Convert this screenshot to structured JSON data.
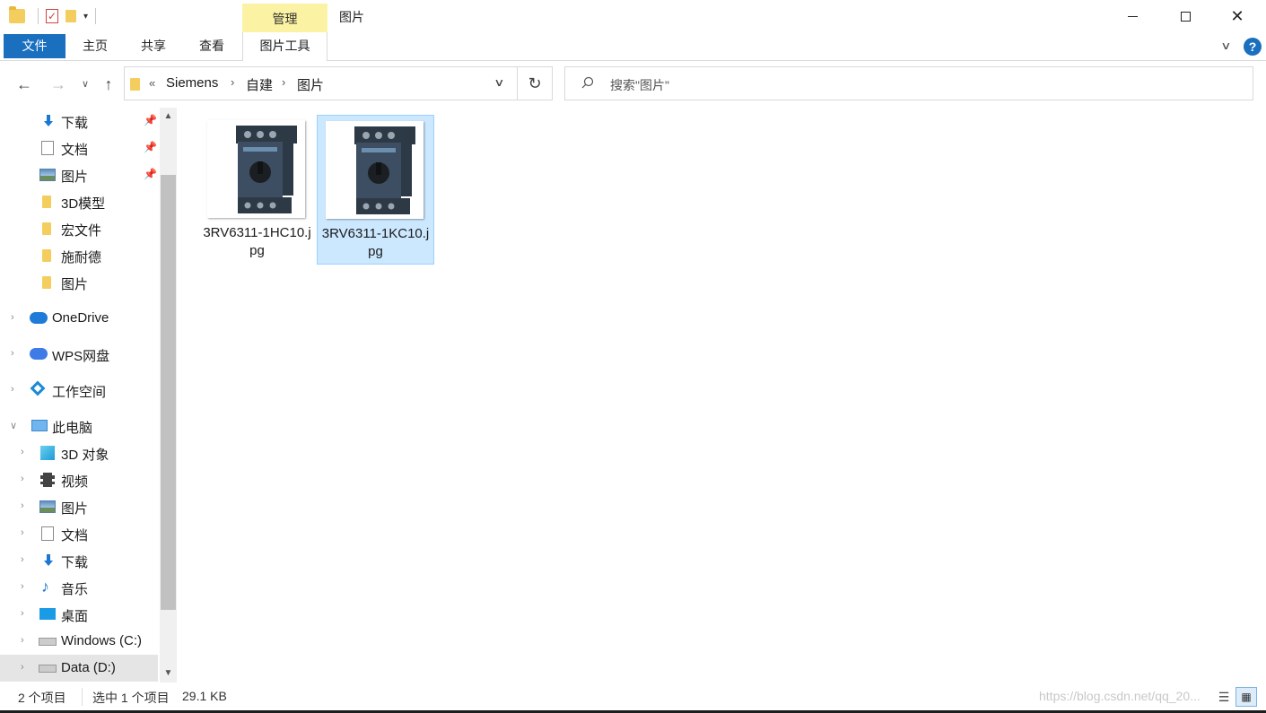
{
  "window": {
    "title": "图片",
    "context_tab": "管理"
  },
  "ribbon": {
    "tabs": [
      "文件",
      "主页",
      "共享",
      "查看",
      "图片工具"
    ]
  },
  "address": {
    "overflow": "«",
    "breadcrumbs": [
      "Siemens",
      "自建",
      "图片"
    ]
  },
  "search": {
    "placeholder": "搜索\"图片\""
  },
  "nav_tree": [
    {
      "label": "下载",
      "icon": "download-icon",
      "pinned": true
    },
    {
      "label": "文档",
      "icon": "document-icon",
      "pinned": true
    },
    {
      "label": "图片",
      "icon": "pictures-icon",
      "pinned": true
    },
    {
      "label": "3D模型",
      "icon": "folder-icon"
    },
    {
      "label": "宏文件",
      "icon": "folder-icon"
    },
    {
      "label": "施耐德",
      "icon": "folder-icon"
    },
    {
      "label": "图片",
      "icon": "folder-icon"
    },
    {
      "label": "OneDrive",
      "icon": "onedrive-cloud-icon"
    },
    {
      "label": "WPS网盘",
      "icon": "wps-cloud-icon"
    },
    {
      "label": "工作空间",
      "icon": "workspace-icon"
    },
    {
      "label": "此电脑",
      "icon": "this-pc-icon"
    },
    {
      "label": "3D 对象",
      "icon": "3d-objects-icon"
    },
    {
      "label": "视频",
      "icon": "video-icon"
    },
    {
      "label": "图片",
      "icon": "pictures-icon"
    },
    {
      "label": "文档",
      "icon": "document-icon"
    },
    {
      "label": "下载",
      "icon": "download-icon"
    },
    {
      "label": "音乐",
      "icon": "music-icon"
    },
    {
      "label": "桌面",
      "icon": "desktop-icon"
    },
    {
      "label": "Windows (C:)",
      "icon": "windows-drive-icon"
    },
    {
      "label": "Data (D:)",
      "icon": "drive-icon"
    }
  ],
  "files": [
    {
      "name": "3RV6311-1HC10.jpg",
      "selected": false
    },
    {
      "name": "3RV6311-1KC10.jpg",
      "selected": true
    }
  ],
  "status": {
    "count": "2 个项目",
    "selection": "选中 1 个项目",
    "size": "29.1 KB",
    "watermark": "https://blog.csdn.net/qq_20..."
  },
  "colors": {
    "accent": "#1a6fbf",
    "context_tab_bg": "#fbf3a3",
    "selection_bg": "#cce8ff",
    "selection_border": "#99d1ff"
  }
}
